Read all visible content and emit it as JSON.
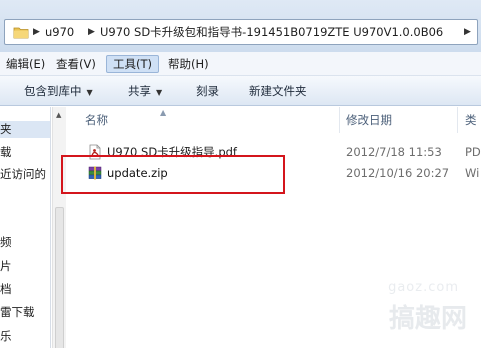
{
  "address": {
    "segments": [
      "u970",
      "U970 SD卡升级包和指导书-191451B0719ZTE U970V1.0.0B06"
    ]
  },
  "menu": {
    "items": [
      {
        "label": "编辑(E)"
      },
      {
        "label": "查看(V)"
      },
      {
        "label": "工具(T)"
      },
      {
        "label": "帮助(H)"
      }
    ],
    "active_index": 2
  },
  "toolbar": {
    "include_in_library": "包含到库中",
    "share": "共享",
    "burn": "刻录",
    "new_folder": "新建文件夹"
  },
  "sidebar": {
    "items": [
      "夹",
      "载",
      "近访问的",
      "频",
      "片",
      "档",
      "雷下载",
      "乐"
    ]
  },
  "columns": {
    "name": "名称",
    "modified": "修改日期",
    "type": "类"
  },
  "files": [
    {
      "name": "U970 SD卡升级指导.pdf",
      "modified": "2012/7/18 11:53",
      "type": "PD",
      "icon": "pdf-file-icon"
    },
    {
      "name": "update.zip",
      "modified": "2012/10/16 20:27",
      "type": "Wi",
      "icon": "winrar-archive-icon"
    }
  ],
  "watermark": {
    "site": "gaoz.com",
    "text": "搞趣网"
  },
  "colors": {
    "highlight_border": "#d4151c",
    "menu_active": "#cfe0f5"
  }
}
